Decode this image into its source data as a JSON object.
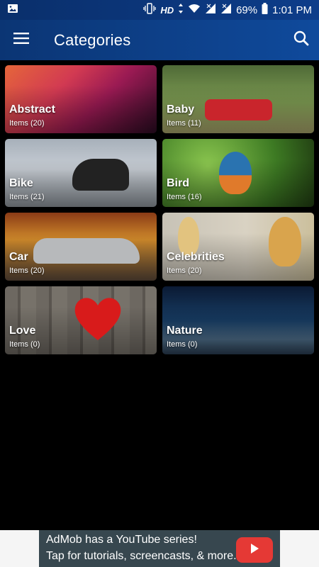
{
  "status_bar": {
    "left_icon": "image-icon",
    "hd_label": "HD",
    "battery_percent": "69%",
    "time": "1:01 PM"
  },
  "app_bar": {
    "title": "Categories",
    "menu_icon": "hamburger-menu-icon",
    "search_icon": "search-icon"
  },
  "categories": [
    {
      "name": "Abstract",
      "count": "Items (20)"
    },
    {
      "name": "Baby",
      "count": "Items (11)"
    },
    {
      "name": "Bike",
      "count": "Items (21)"
    },
    {
      "name": "Bird",
      "count": "Items (16)"
    },
    {
      "name": "Car",
      "count": "Items (20)"
    },
    {
      "name": "Celebrities",
      "count": "Items (20)"
    },
    {
      "name": "Love",
      "count": "Items (0)"
    },
    {
      "name": "Nature",
      "count": "Items (0)"
    }
  ],
  "ad": {
    "line1": "AdMob has a YouTube series!",
    "line2": "Tap for tutorials, screencasts, & more."
  },
  "colors": {
    "app_bar": "#0b3574",
    "background": "#000000",
    "ad_bg": "#37474f",
    "ad_button": "#e53935"
  }
}
